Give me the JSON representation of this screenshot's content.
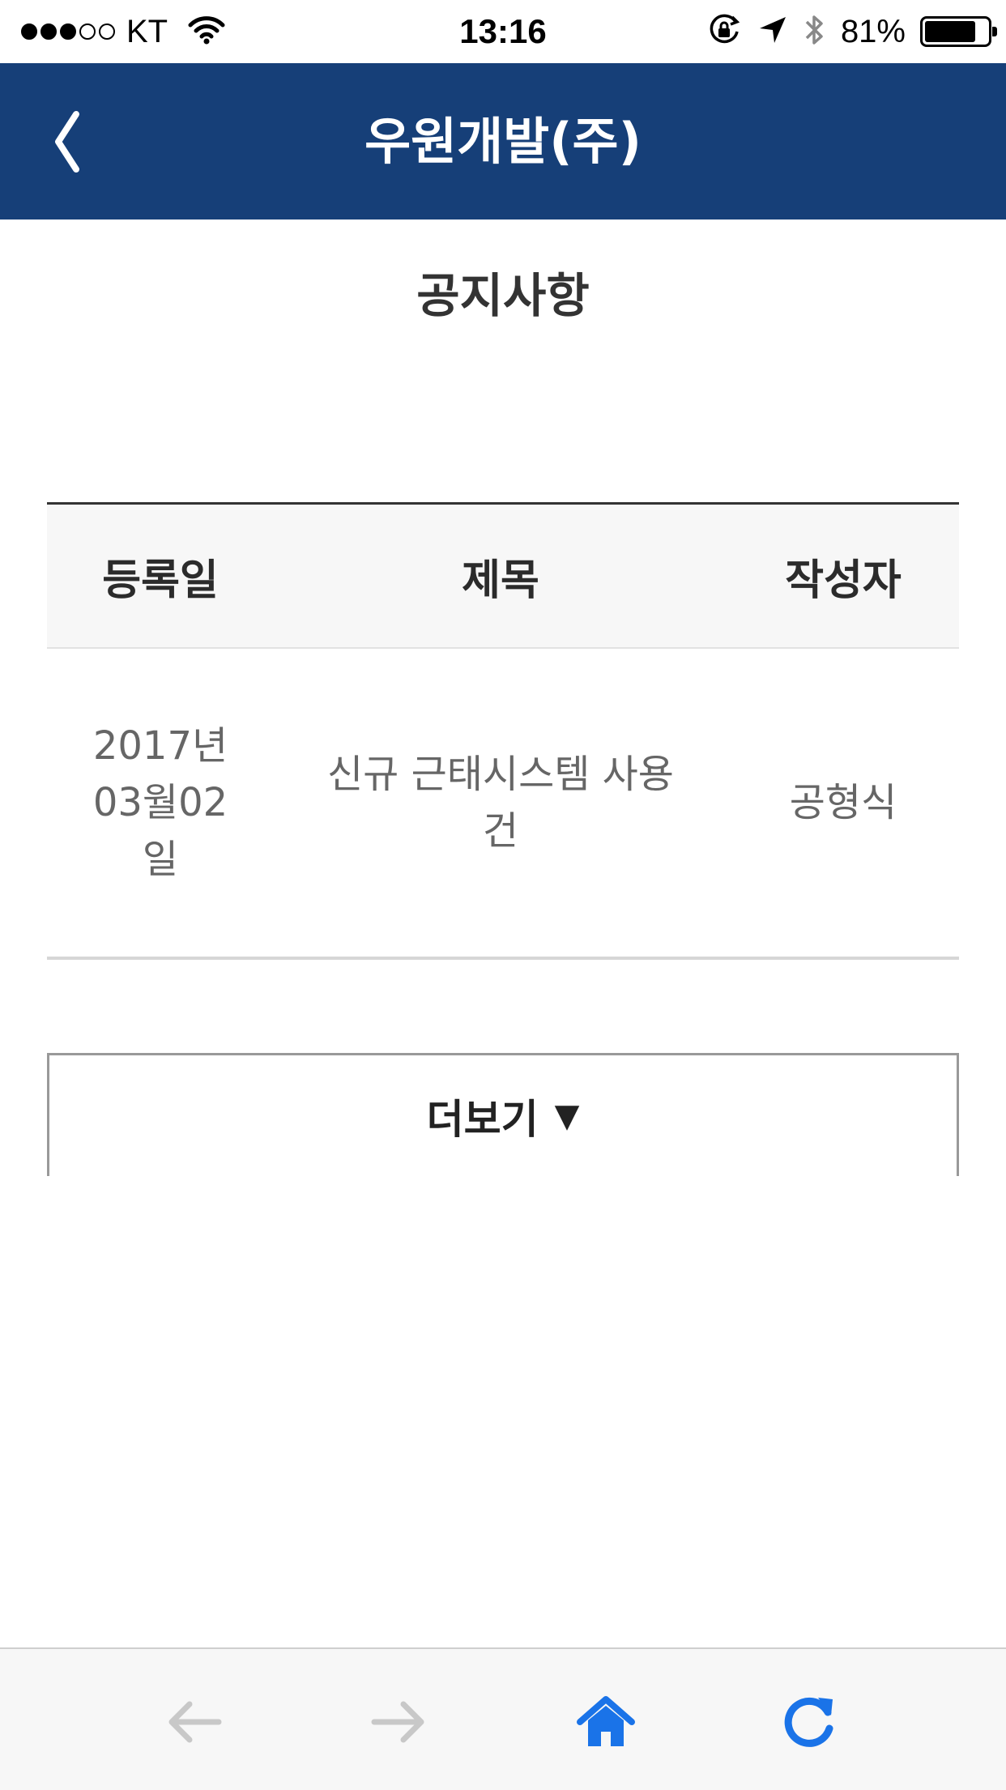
{
  "status_bar": {
    "carrier": "KT",
    "time": "13:16",
    "battery_percent": "81%",
    "battery_level": 0.81,
    "signal_bars_filled": 3,
    "signal_bars_total": 5
  },
  "header": {
    "title": "우원개발(주)",
    "background_color": "#163f78"
  },
  "page": {
    "title": "공지사항"
  },
  "table": {
    "columns": [
      "등록일",
      "제목",
      "작성자"
    ],
    "rows": [
      {
        "date": "2017년03월02일",
        "title": "신규 근태시스템 사용 건",
        "author": "공형식"
      }
    ]
  },
  "more_button": {
    "label": "더보기",
    "arrow": "▼"
  },
  "bottom_nav": {
    "icons": [
      "back-arrow-icon",
      "forward-arrow-icon",
      "home-icon",
      "refresh-icon"
    ],
    "accent_color": "#1a73e8",
    "disabled_color": "#c8c8c8"
  }
}
